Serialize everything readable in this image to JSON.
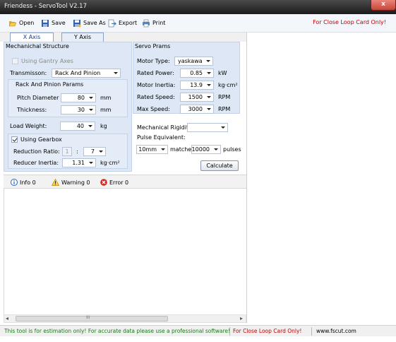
{
  "window": {
    "title": "Friendess - ServoTool V2.17",
    "close_glyph": "x"
  },
  "toolbar": {
    "open_label": "Open",
    "save_label": "Save",
    "save_as_label": "Save As",
    "export_label": "Export",
    "print_label": "Print",
    "notice": "For Close Loop Card Only!"
  },
  "tabs": [
    {
      "label": "X Axis",
      "selected": true
    },
    {
      "label": "Y Axis",
      "selected": false
    }
  ],
  "mechanical": {
    "title": "Mechanichal Structure",
    "gantry_label": "Using Gantry Axes",
    "gantry_checked": false,
    "transmission_label": "Transmisson:",
    "transmission_value": "Rack And Pinion",
    "rack_title": "Rack And Pinion Params",
    "pitch_label": "Pitch Diameter",
    "pitch_value": "80",
    "pitch_unit": "mm",
    "thickness_label": "Thickness:",
    "thickness_value": "30",
    "thickness_unit": "mm",
    "load_label": "Load Weight:",
    "load_value": "40",
    "load_unit": "kg",
    "gearbox_label": "Using Gearbox",
    "gearbox_checked": true,
    "ratio_label": "Reduction Ratio:",
    "ratio_left": "1",
    "ratio_colon": ":",
    "ratio_right": "7",
    "inertia_label": "Reducer Inertia:",
    "inertia_value": "1.31",
    "inertia_unit": "kg·cm²"
  },
  "servo": {
    "title": "Servo Prams",
    "motor_type_label": "Motor Type:",
    "motor_type_value": "yaskawa",
    "power_label": "Rated Power:",
    "power_value": "0.85",
    "power_unit": "kW",
    "inertia_label": "Motor Inertia:",
    "inertia_value": "13.9",
    "inertia_unit": "kg·cm²",
    "speed_label": "Rated Speed:",
    "speed_value": "1500",
    "speed_unit": "RPM",
    "max_speed_label": "Max Speed:",
    "max_speed_value": "3000",
    "max_speed_unit": "RPM",
    "rigidity_label": "Mechanical Rigidity:",
    "rigidity_value": "",
    "pulse_label": "Pulse Equivalent:",
    "pulse_mm_value": "10mm",
    "matches_label": "matches",
    "pulse_count_value": "10000",
    "pulses_label": "pulses",
    "calculate_label": "Calculate"
  },
  "messages": {
    "info_label": "Info 0",
    "warning_label": "Warning 0",
    "error_label": "Error 0",
    "scroll_glyph": "III",
    "left_arrow": "◂",
    "right_arrow": "▸"
  },
  "status": {
    "estimate": "This tool is for estimation only! For accurate data please use a professional software!",
    "closeloop": "For Close Loop Card Only!",
    "website": "www.fscut.com"
  },
  "colors": {
    "group_bg": "#dde7f5",
    "status_green": "#1a7a1a",
    "warn_red": "#c00000"
  }
}
